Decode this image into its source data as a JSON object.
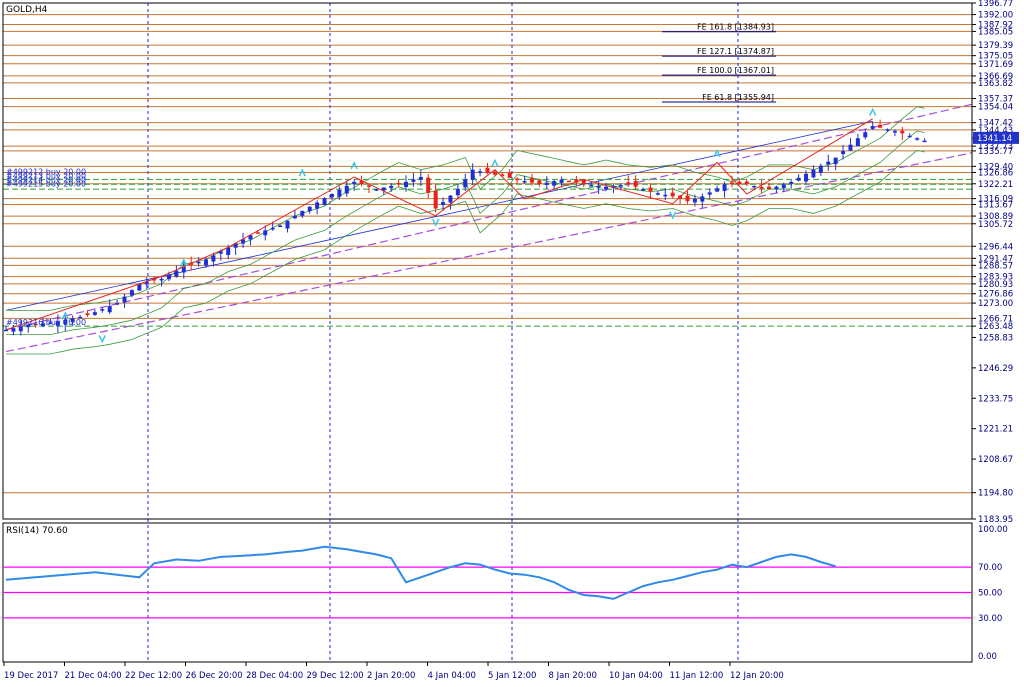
{
  "window": {
    "title": "GOLD,H4"
  },
  "colors": {
    "up_candle": "#1f2fd6",
    "down_candle": "#e8231b",
    "hline": "#c87533",
    "vline": "#1a2bd8",
    "axis": "#000080",
    "trend_channel": "#a64ddb",
    "zigzag": "#e8231b",
    "bb": "#3c9a3c",
    "fractal": "#32c8e8",
    "rsi": "#2f8ae8",
    "rsi_level": "#ff00ff",
    "price_box": "#2233cc",
    "trade_line": "#2ea02e"
  },
  "price_axis_labels": [
    "1396.77",
    "1392.00",
    "1387.92",
    "1385.05",
    "1379.39",
    "1375.05",
    "1371.69",
    "1366.69",
    "1363.82",
    "1357.37",
    "1354.04",
    "1347.42",
    "1344.43",
    "1341.14",
    "1337.73",
    "1335.77",
    "1329.40",
    "1326.86",
    "1322.21",
    "1316.09",
    "1313.67",
    "1308.89",
    "1305.72",
    "1296.44",
    "1291.47",
    "1288.57",
    "1283.93",
    "1280.93",
    "1276.86",
    "1273.00",
    "1266.71",
    "1263.48",
    "1258.83",
    "1246.29",
    "1233.75",
    "1221.21",
    "1208.67",
    "1194.80",
    "1183.95"
  ],
  "time_axis_labels": [
    "19 Dec 2017",
    "21 Dec 04:00",
    "22 Dec 12:00",
    "26 Dec 20:00",
    "28 Dec 04:00",
    "29 Dec 12:00",
    "2 Jan 20:00",
    "4 Jan 04:00",
    "5 Jan 12:00",
    "8 Jan 20:00",
    "10 Jan 04:00",
    "11 Jan 12:00",
    "12 Jan 20:00"
  ],
  "fibo_expansion": [
    {
      "label": "FE 161.8",
      "price": "1384.93"
    },
    {
      "label": "FE 127.1",
      "price": "1374.87"
    },
    {
      "label": "FE 100.0",
      "price": "1367.01"
    },
    {
      "label": "FE 61.8",
      "price": "1355.94"
    }
  ],
  "current_price": "1341.14",
  "trade_labels": [
    "#499212 buy 20.00",
    "#499213 buy 20.00",
    "#499214 buy 20.00",
    "#499215 buy 20.00"
  ],
  "bottom_trade_label": "#499216 buy 20.00",
  "rsi": {
    "title": "RSI(14) 70.60",
    "axis_labels": [
      "100.00",
      "70.00",
      "50.00",
      "30.00",
      "0.00"
    ]
  },
  "chart_data": [
    {
      "type": "candlestick",
      "title": "GOLD,H4",
      "x": [
        "19 Dec 2017",
        "21 Dec 04:00",
        "22 Dec 12:00",
        "26 Dec 20:00",
        "28 Dec 04:00",
        "29 Dec 12:00",
        "2 Jan 20:00",
        "4 Jan 04:00",
        "5 Jan 12:00",
        "8 Jan 20:00",
        "10 Jan 04:00",
        "11 Jan 12:00",
        "12 Jan 20:00"
      ],
      "ylim": [
        1183.95,
        1396.77
      ],
      "grid": false,
      "close_path": [
        [
          0,
          1262
        ],
        [
          3,
          1264
        ],
        [
          6,
          1265
        ],
        [
          8,
          1266
        ],
        [
          11,
          1268
        ],
        [
          15,
          1273
        ],
        [
          18,
          1281
        ],
        [
          21,
          1283
        ],
        [
          24,
          1288
        ],
        [
          27,
          1291
        ],
        [
          30,
          1296
        ],
        [
          33,
          1301
        ],
        [
          37,
          1305
        ],
        [
          40,
          1311
        ],
        [
          44,
          1318
        ],
        [
          47,
          1323
        ],
        [
          50,
          1320
        ],
        [
          53,
          1322
        ],
        [
          56,
          1325
        ],
        [
          58,
          1312
        ],
        [
          61,
          1320
        ],
        [
          63,
          1328
        ],
        [
          66,
          1326
        ],
        [
          69,
          1324
        ],
        [
          72,
          1322
        ],
        [
          75,
          1324
        ],
        [
          78,
          1322
        ],
        [
          81,
          1321
        ],
        [
          84,
          1322
        ],
        [
          87,
          1319
        ],
        [
          90,
          1317
        ],
        [
          92,
          1315
        ],
        [
          94,
          1317
        ],
        [
          97,
          1322
        ],
        [
          100,
          1322
        ],
        [
          103,
          1320
        ],
        [
          106,
          1323
        ],
        [
          109,
          1328
        ],
        [
          112,
          1333
        ],
        [
          115,
          1341
        ],
        [
          117,
          1346
        ],
        [
          120,
          1344
        ],
        [
          122,
          1342
        ],
        [
          124,
          1340
        ]
      ],
      "horizontal_levels": [
        1392.0,
        1387.92,
        1385.05,
        1379.39,
        1375.05,
        1371.69,
        1366.69,
        1363.82,
        1357.37,
        1354.04,
        1347.42,
        1344.43,
        1337.73,
        1335.77,
        1329.4,
        1326.86,
        1322.21,
        1316.09,
        1313.67,
        1308.89,
        1305.72,
        1296.44,
        1291.47,
        1288.57,
        1283.93,
        1280.93,
        1276.86,
        1273.0,
        1266.71,
        1194.8
      ]
    },
    {
      "type": "line",
      "title": "RSI(14) 70.60",
      "ylim": [
        0,
        100
      ],
      "levels": [
        70,
        50,
        30
      ],
      "values": [
        [
          0,
          60
        ],
        [
          4,
          62
        ],
        [
          8,
          64
        ],
        [
          12,
          66
        ],
        [
          15,
          64
        ],
        [
          18,
          62
        ],
        [
          20,
          73
        ],
        [
          23,
          76
        ],
        [
          26,
          75
        ],
        [
          29,
          78
        ],
        [
          32,
          79
        ],
        [
          35,
          80
        ],
        [
          38,
          82
        ],
        [
          40,
          83
        ],
        [
          43,
          86
        ],
        [
          46,
          84
        ],
        [
          48,
          82
        ],
        [
          50,
          80
        ],
        [
          52,
          77
        ],
        [
          54,
          58
        ],
        [
          56,
          62
        ],
        [
          58,
          66
        ],
        [
          60,
          70
        ],
        [
          62,
          73
        ],
        [
          64,
          72
        ],
        [
          66,
          68
        ],
        [
          68,
          65
        ],
        [
          70,
          64
        ],
        [
          72,
          62
        ],
        [
          74,
          58
        ],
        [
          76,
          52
        ],
        [
          78,
          48
        ],
        [
          80,
          47
        ],
        [
          82,
          45
        ],
        [
          84,
          50
        ],
        [
          86,
          55
        ],
        [
          88,
          58
        ],
        [
          90,
          60
        ],
        [
          92,
          63
        ],
        [
          94,
          66
        ],
        [
          96,
          68
        ],
        [
          98,
          72
        ],
        [
          100,
          70
        ],
        [
          102,
          74
        ],
        [
          104,
          78
        ],
        [
          106,
          80
        ],
        [
          108,
          78
        ],
        [
          110,
          74
        ],
        [
          112,
          70.6
        ]
      ]
    }
  ]
}
